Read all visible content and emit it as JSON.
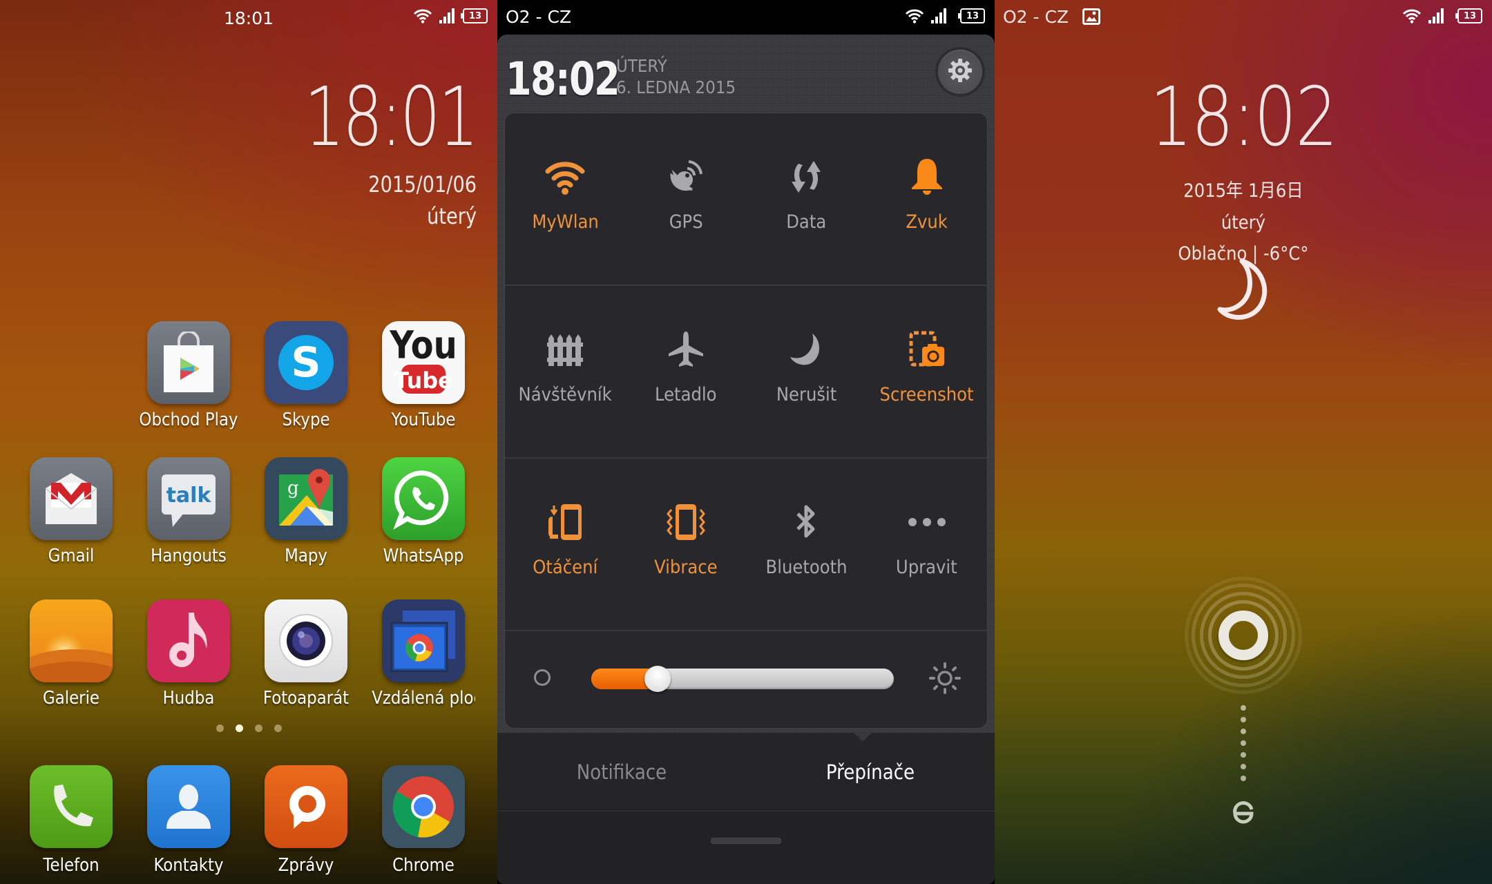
{
  "home": {
    "status_bar": {
      "time": "18:01",
      "battery": "13"
    },
    "clock": {
      "time": "18:01",
      "date": "2015/01/06",
      "day": "úterý"
    },
    "apps": [
      {
        "label": "Obchod Play",
        "icon": "play-store-icon"
      },
      {
        "label": "Skype",
        "icon": "skype-icon"
      },
      {
        "label": "YouTube",
        "icon": "youtube-icon"
      },
      {
        "label": "Gmail",
        "icon": "gmail-icon"
      },
      {
        "label": "Hangouts",
        "icon": "hangouts-talk-icon"
      },
      {
        "label": "Mapy",
        "icon": "maps-icon"
      },
      {
        "label": "WhatsApp",
        "icon": "whatsapp-icon"
      },
      {
        "label": "Galerie",
        "icon": "gallery-sunset-icon"
      },
      {
        "label": "Hudba",
        "icon": "music-note-icon"
      },
      {
        "label": "Fotoaparát",
        "icon": "camera-lens-icon"
      },
      {
        "label": "Vzdálená plocha",
        "icon": "remote-desktop-chrome-icon"
      }
    ],
    "page_indicator": {
      "count": 4,
      "active_index": 1
    },
    "dock": [
      {
        "label": "Telefon",
        "icon": "phone-icon"
      },
      {
        "label": "Kontakty",
        "icon": "contact-person-icon"
      },
      {
        "label": "Zprávy",
        "icon": "messages-bubble-icon"
      },
      {
        "label": "Chrome",
        "icon": "chrome-icon"
      }
    ]
  },
  "control_center": {
    "status_bar": {
      "carrier": "O2 - CZ",
      "battery": "13"
    },
    "header": {
      "time": "18:02",
      "weekday": "ÚTERÝ",
      "date": "6. LEDNA 2015"
    },
    "toggles": [
      {
        "label": "MyWlan",
        "icon": "wifi-icon",
        "active": true
      },
      {
        "label": "GPS",
        "icon": "gps-satellite-icon",
        "active": false
      },
      {
        "label": "Data",
        "icon": "data-sync-arrows-icon",
        "active": false
      },
      {
        "label": "Zvuk",
        "icon": "bell-icon",
        "active": true
      },
      {
        "label": "Návštěvník",
        "icon": "fence-icon",
        "active": false
      },
      {
        "label": "Letadlo",
        "icon": "airplane-icon",
        "active": false
      },
      {
        "label": "Nerušit",
        "icon": "moon-icon",
        "active": false
      },
      {
        "label": "Screenshot",
        "icon": "screenshot-camera-icon",
        "active": true
      },
      {
        "label": "Otáčení",
        "icon": "rotation-icon",
        "active": true
      },
      {
        "label": "Vibrace",
        "icon": "vibration-icon",
        "active": true
      },
      {
        "label": "Bluetooth",
        "icon": "bluetooth-icon",
        "active": false
      },
      {
        "label": "Upravit",
        "icon": "more-dots-icon",
        "active": false
      }
    ],
    "brightness": {
      "value_percent": 22
    },
    "tabs": [
      {
        "label": "Notifikace",
        "active": false
      },
      {
        "label": "Přepínače",
        "active": true
      }
    ],
    "colors": {
      "accent": "#f0923c",
      "inactive": "#a8a8ac"
    }
  },
  "lock_screen": {
    "status_bar": {
      "carrier": "O2 - CZ",
      "battery": "13"
    },
    "clock": {
      "time": "18:02",
      "date": "2015年 1月6日",
      "day": "úterý",
      "weather": "Oblačno  |  -6°C°"
    }
  }
}
